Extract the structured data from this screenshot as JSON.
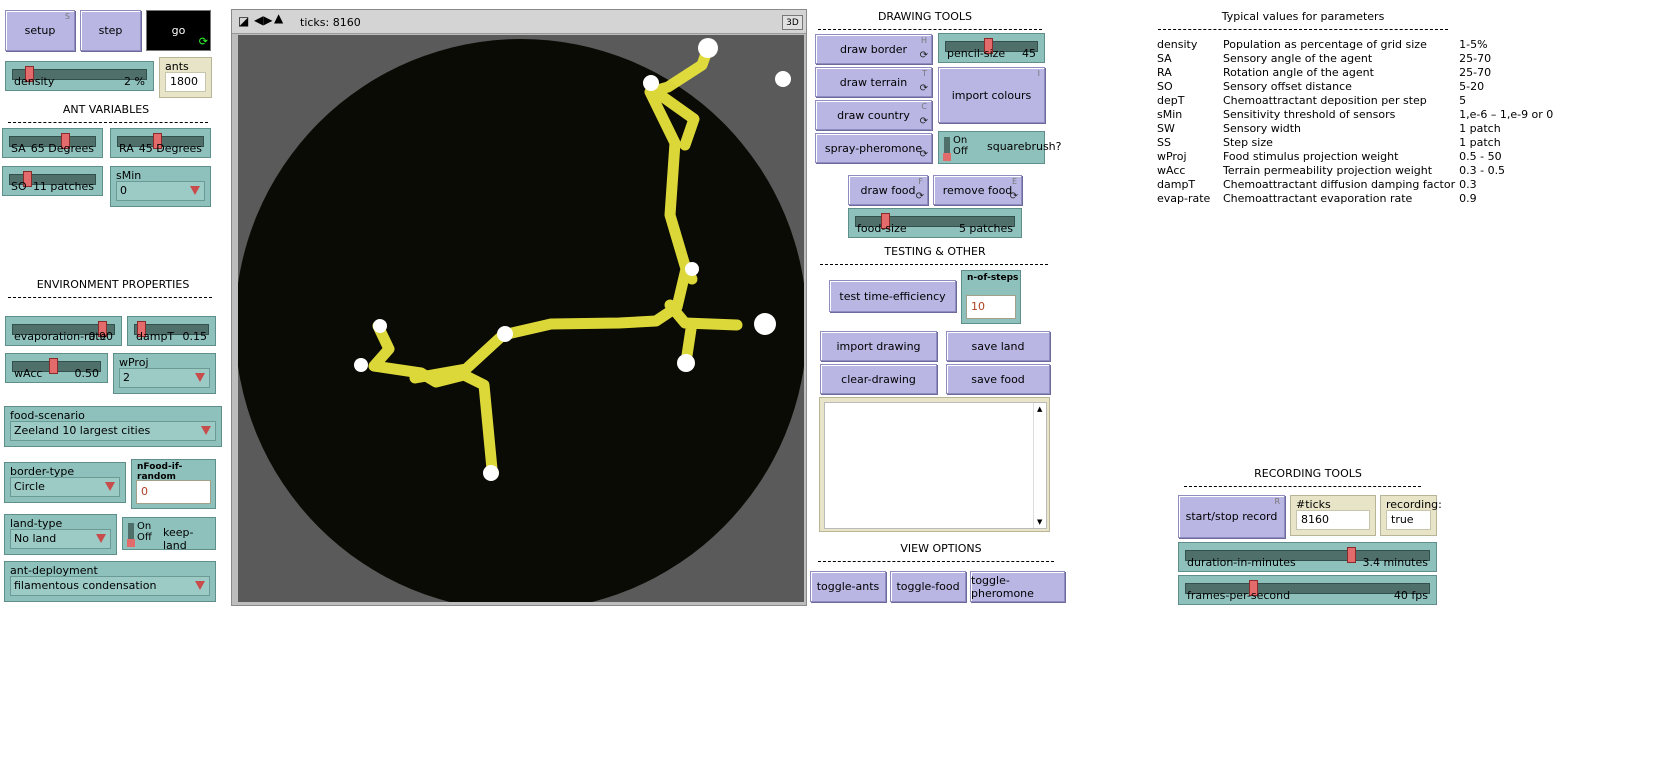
{
  "left_panel": {
    "setup": {
      "label": "setup",
      "key": "S"
    },
    "step": {
      "label": "step"
    },
    "go": {
      "label": "go"
    },
    "density": {
      "name": "density",
      "value": "2 %",
      "fraction": 0.1
    },
    "ants": {
      "name": "ants",
      "value": "1800"
    },
    "ant_variables_title": "ANT VARIABLES",
    "SA": {
      "name": "SA",
      "value": "65 Degrees",
      "fraction": 0.65
    },
    "RA": {
      "name": "RA",
      "value": "45 Degrees",
      "fraction": 0.45
    },
    "SO": {
      "name": "SO",
      "value": "11 patches",
      "fraction": 0.17
    },
    "sMin": {
      "name": "sMin",
      "value": "0"
    },
    "environment_title": "ENVIRONMENT PROPERTIES",
    "evaporation_rate": {
      "name": "evaporation-rate",
      "value": "0.90",
      "fraction": 0.9
    },
    "dampT": {
      "name": "dampT",
      "value": "0.15",
      "fraction": 0.05
    },
    "wAcc": {
      "name": "wAcc",
      "value": "0.50",
      "fraction": 0.45
    },
    "wProj": {
      "name": "wProj",
      "value": "2"
    },
    "food_scenario": {
      "name": "food-scenario",
      "value": "Zeeland 10 largest cities"
    },
    "border_type": {
      "name": "border-type",
      "value": "Circle"
    },
    "nFood_if_random": {
      "name": "nFood-if-random",
      "value": "0"
    },
    "land_type": {
      "name": "land-type",
      "value": "No land"
    },
    "keep_land": {
      "name": "keep-land",
      "on": "On",
      "off": "Off"
    },
    "ant_deployment": {
      "name": "ant-deployment",
      "value": "filamentous condensation"
    }
  },
  "view": {
    "ticks_label": "ticks: 8160",
    "three_d": "3D",
    "background": "#0a0b05",
    "corner_gray": "#5a5a5a",
    "network_color": "#e8e33c"
  },
  "drawing_tools": {
    "title": "DRAWING TOOLS",
    "draw_border": {
      "label": "draw border",
      "key": "H"
    },
    "pencil_size": {
      "name": "pencil-size",
      "value": "45",
      "fraction": 0.45
    },
    "draw_terrain": {
      "label": "draw terrain",
      "key": "T"
    },
    "import_colours": {
      "label": "import colours",
      "key": "I"
    },
    "draw_country": {
      "label": "draw country",
      "key": "C"
    },
    "spray_pheromone": {
      "label": "spray-pheromone"
    },
    "squarebrush": {
      "name": "squarebrush?",
      "on": "On",
      "off": "Off"
    },
    "draw_food": {
      "label": "draw food",
      "key": "F"
    },
    "remove_food": {
      "label": "remove food",
      "key": "E"
    },
    "food_size": {
      "name": "food-size",
      "value": "5 patches",
      "fraction": 0.17
    }
  },
  "testing": {
    "title": "TESTING & OTHER",
    "test_time_efficiency": {
      "label": "test time-efficiency"
    },
    "n_of_steps": {
      "name": "n-of-steps",
      "value": "10"
    },
    "import_drawing": {
      "label": "import drawing"
    },
    "save_land": {
      "label": "save land"
    },
    "clear_drawing": {
      "label": "clear-drawing"
    },
    "save_food": {
      "label": "save food"
    }
  },
  "view_options": {
    "title": "VIEW OPTIONS",
    "toggle_ants": {
      "label": "toggle-ants"
    },
    "toggle_food": {
      "label": "toggle-food"
    },
    "toggle_pheromone": {
      "label": "toggle-pheromone"
    }
  },
  "parameters": {
    "title": "Typical values for parameters",
    "rows": [
      [
        "density",
        "Population as percentage of grid size",
        "1-5%"
      ],
      [
        "SA",
        "Sensory angle of the agent",
        "25-70"
      ],
      [
        "RA",
        "Rotation angle of the agent",
        "25-70"
      ],
      [
        "SO",
        "Sensory offset distance",
        "5-20"
      ],
      [
        "depT",
        "Chemoattractant deposition per step",
        "5"
      ],
      [
        "sMin",
        "Sensitivity threshold of sensors",
        "1,e-6 – 1,e-9 or 0"
      ],
      [
        "SW",
        "Sensory width",
        "1 patch"
      ],
      [
        "SS",
        "Step size",
        "1 patch"
      ],
      [
        "wProj",
        "Food stimulus projection weight",
        "0.5 - 50"
      ],
      [
        "wAcc",
        "Terrain permeability projection weight",
        "0.3 - 0.5"
      ],
      [
        "dampT",
        "Chemoattractant diffusion damping factor",
        "0.3"
      ],
      [
        "evap-rate",
        "Chemoattractant evaporation rate",
        "0.9"
      ]
    ]
  },
  "recording": {
    "title": "RECORDING TOOLS",
    "start_stop": {
      "label": "start/stop record",
      "key": "R"
    },
    "ticks_recording": {
      "name": "#ticks recording:",
      "value": "8160"
    },
    "recording_state": {
      "name": "recording:",
      "value": "true"
    },
    "duration": {
      "name": "duration-in-minutes",
      "value": "3.4 minutes",
      "fraction": 0.68
    },
    "fps": {
      "name": "frames-per-second",
      "value": "40 fps",
      "fraction": 0.27
    }
  }
}
